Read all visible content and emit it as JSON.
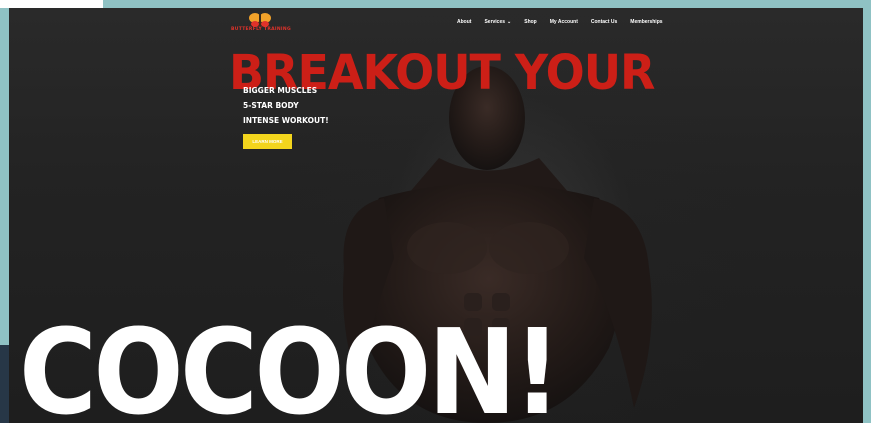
{
  "brand": {
    "logo_text": "BUTTERFLY TRAINING",
    "colors": {
      "accent_red": "#cc1f17",
      "cta_yellow": "#f3d51d",
      "logo_orange": "#f2a22a"
    }
  },
  "nav": {
    "items": [
      {
        "label": "About"
      },
      {
        "label": "Services",
        "has_dropdown": true,
        "icon": "chevron-down-icon"
      },
      {
        "label": "Shop"
      },
      {
        "label": "My Account"
      },
      {
        "label": "Contact Us"
      },
      {
        "label": "Memberships"
      }
    ]
  },
  "hero": {
    "headline": "BREAKOUT YOUR",
    "taglines": [
      "BIGGER MUSCLES",
      "5-STAR BODY",
      "INTENSE WORKOUT!"
    ],
    "cta_label": "LEARN MORE",
    "big_word": "COCOON!"
  }
}
